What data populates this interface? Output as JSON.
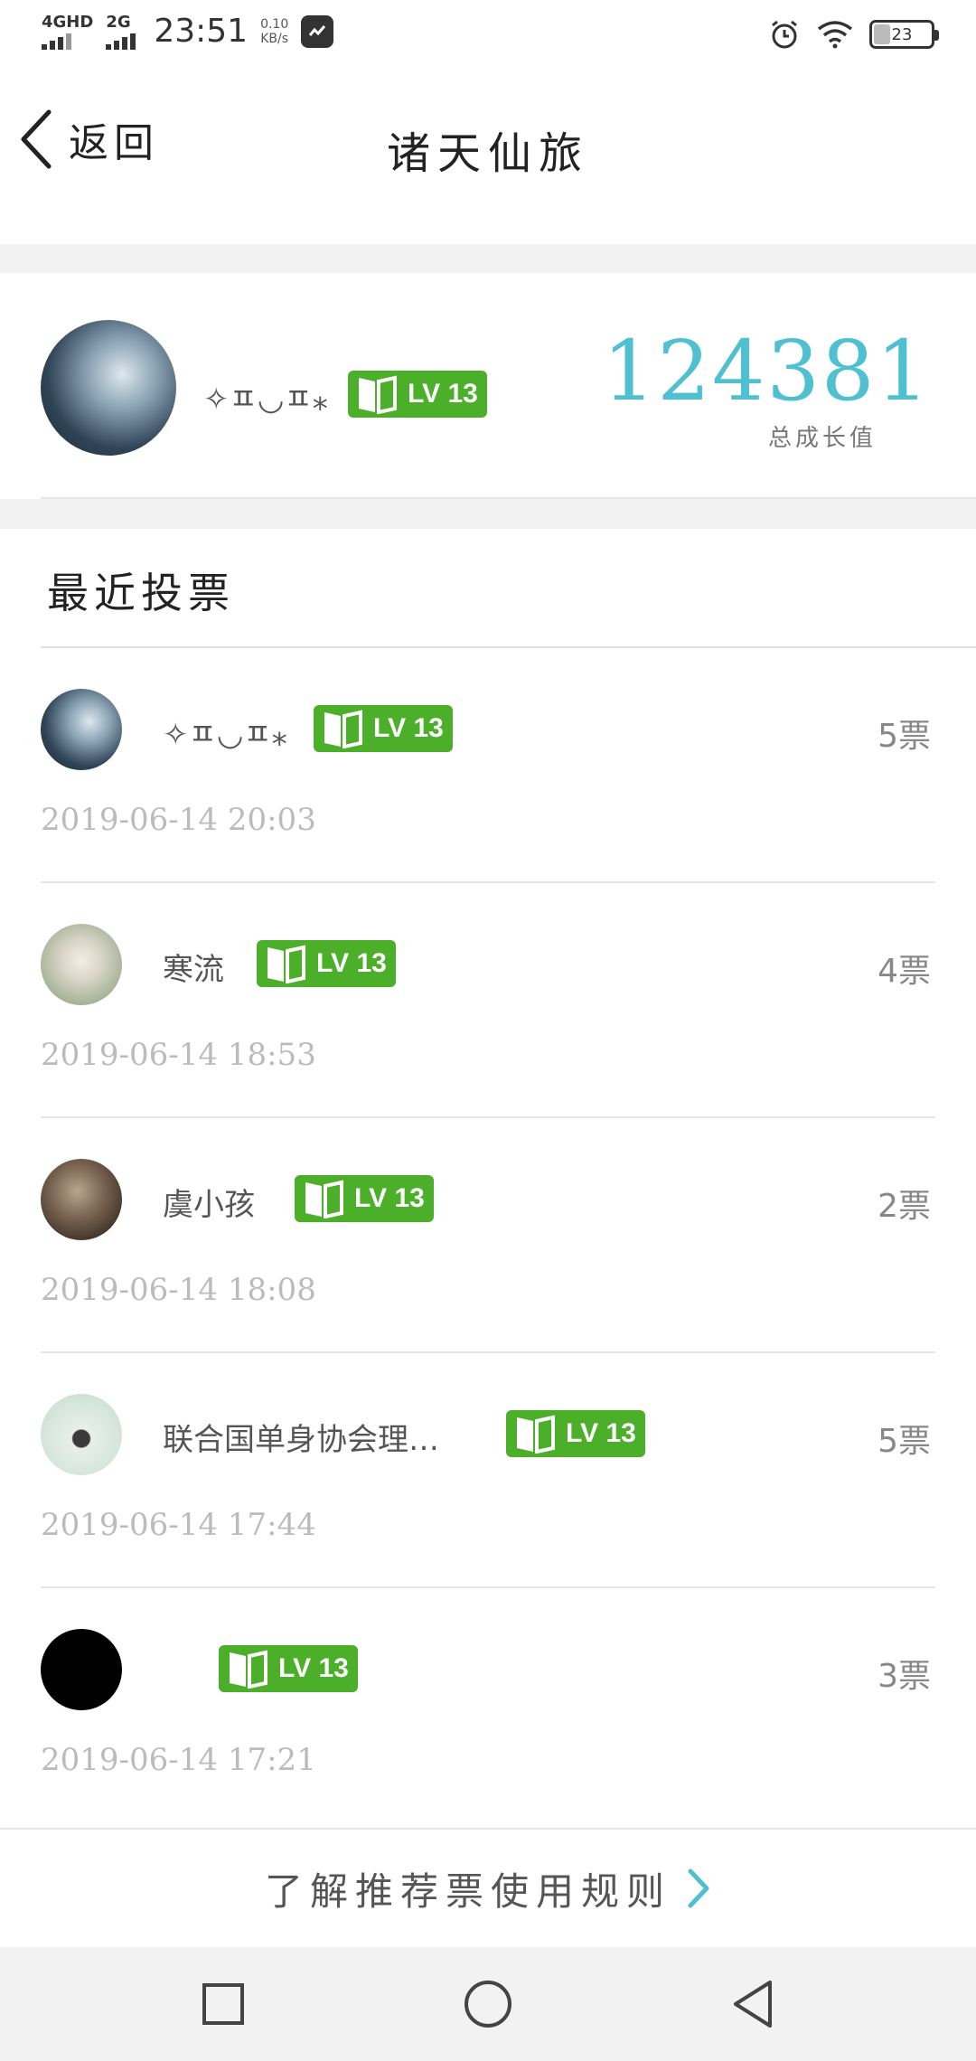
{
  "status_bar": {
    "network1": "4GHD",
    "network2": "2G",
    "time": "23:51",
    "speed_value": "0.10",
    "speed_unit": "KB/s",
    "battery": "23"
  },
  "header": {
    "back_label": "返回",
    "title": "诸天仙旅"
  },
  "profile": {
    "name": "✧ㅍ◡ㅍ⁎",
    "level": "LV 13",
    "growth_value": "124381",
    "growth_label": "总成长值"
  },
  "recent_votes": {
    "title": "最近投票",
    "items": [
      {
        "name": "✧ㅍ◡ㅍ⁎",
        "level": "LV 13",
        "votes": "5票",
        "date": "2019-06-14 20:03"
      },
      {
        "name": "寒流",
        "level": "LV 13",
        "votes": "4票",
        "date": "2019-06-14 18:53"
      },
      {
        "name": "虞小孩",
        "level": "LV 13",
        "votes": "2票",
        "date": "2019-06-14 18:08"
      },
      {
        "name": "联合国单身协会理…",
        "level": "LV 13",
        "votes": "5票",
        "date": "2019-06-14 17:44"
      },
      {
        "name": "",
        "level": "LV 13",
        "votes": "3票",
        "date": "2019-06-14 17:21"
      }
    ]
  },
  "footer": {
    "rules_link": "了解推荐票使用规则"
  },
  "colors": {
    "accent": "#4fc0d0",
    "badge_green": "#4caf2a"
  }
}
